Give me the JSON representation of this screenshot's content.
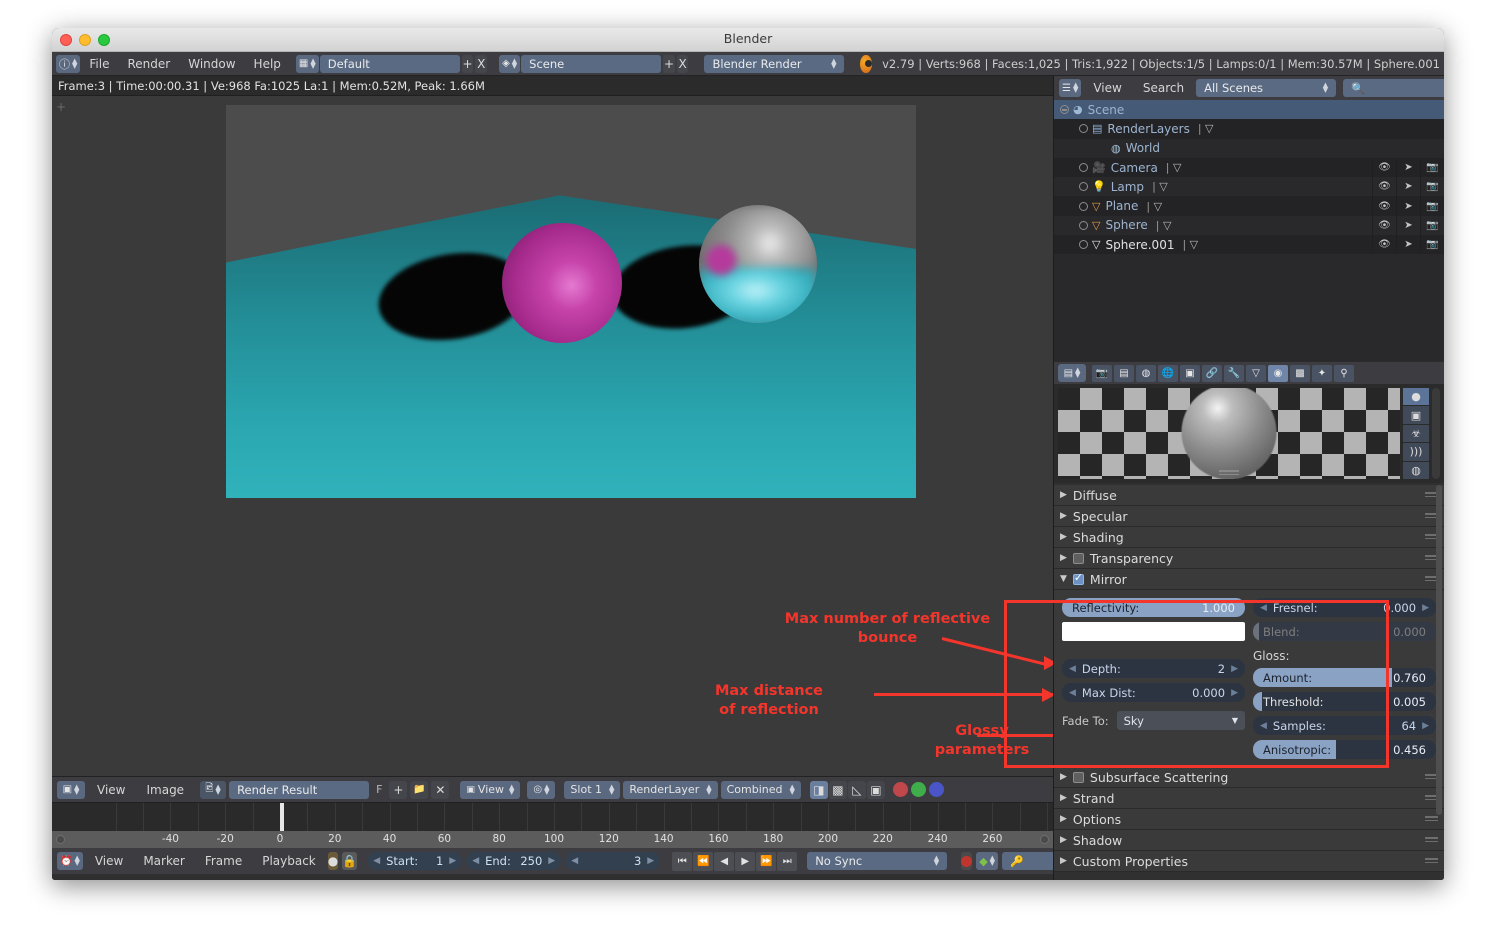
{
  "window": {
    "title": "Blender"
  },
  "topbar": {
    "info_icon": "info-icon",
    "menus": [
      "File",
      "Render",
      "Window",
      "Help"
    ],
    "screen_layout": "Default",
    "scene_name": "Scene",
    "engine": "Blender Render",
    "add_label": "+",
    "close_label": "X",
    "stats": "v2.79 | Verts:968 | Faces:1,025 | Tris:1,922 | Objects:1/5 | Lamps:0/1 | Mem:30.57M | Sphere.001"
  },
  "viewport": {
    "info": "Frame:3 | Time:00:00.31 | Ve:968 Fa:1025 La:1 | Mem:0.52M, Peak: 1.66M"
  },
  "annotations": [
    {
      "text": "Max number of reflective\nbounce"
    },
    {
      "text": "Max distance\nof reflection"
    },
    {
      "text": "Glossy\nparameters"
    }
  ],
  "image_editor": {
    "menus": [
      "View",
      "Image"
    ],
    "datablock": "Render Result",
    "fake_user": "F",
    "new_label": "+",
    "browse_label": "open-icon",
    "unlink_label": "X",
    "view_label": "View",
    "slot": "Slot 1",
    "layer": "RenderLayer",
    "pass": "Combined",
    "channel_buttons": [
      "color-and-alpha-icon",
      "alpha-icon",
      "z-depth-icon",
      "render-icon"
    ],
    "channel_dots": [
      "#c0484b",
      "#4caf50",
      "#4a56c8"
    ]
  },
  "image_ruler": {
    "labels": [
      "-40",
      "-20",
      "0",
      "20",
      "40",
      "60",
      "80",
      "100",
      "120",
      "140",
      "160",
      "180",
      "200",
      "220",
      "240",
      "260"
    ],
    "values": [
      -40,
      -20,
      0,
      20,
      40,
      60,
      80,
      100,
      120,
      140,
      160,
      180,
      200,
      220,
      240,
      260
    ]
  },
  "timeline": {
    "menus": [
      "View",
      "Marker",
      "Frame",
      "Playback"
    ],
    "auto_key_icon": "record-keying-icon",
    "lock_icon": "lock-icon",
    "start_label": "Start:",
    "start_value": "1",
    "end_label": "End:",
    "end_value": "250",
    "current_frame": "3",
    "transport": [
      "jump-start-icon",
      "prev-keyframe-icon",
      "play-reverse-icon",
      "play-icon",
      "next-keyframe-icon",
      "jump-end-icon"
    ],
    "sync_mode": "No Sync",
    "record_icon": "record-icon",
    "keying_set_icon": "keyingset-icon",
    "keyframe_type_icon": "keyframe-icon"
  },
  "outliner": {
    "header": {
      "display_mode_icon": "outliner-icon",
      "view": "View",
      "search": "Search",
      "scope": "All Scenes",
      "search_placeholder": ""
    },
    "rows": [
      {
        "name": "Scene",
        "indent": 0,
        "selected": true,
        "type": "scene",
        "toggles": false,
        "extra": ""
      },
      {
        "name": "RenderLayers",
        "indent": 1,
        "selected": false,
        "type": "layers",
        "toggles": false,
        "extra": "renderlayer-icon"
      },
      {
        "name": "World",
        "indent": 2,
        "selected": false,
        "type": "world",
        "toggles": false,
        "extra": ""
      },
      {
        "name": "Camera",
        "indent": 1,
        "selected": false,
        "type": "camera",
        "toggles": true,
        "extra": "camera-data-icon"
      },
      {
        "name": "Lamp",
        "indent": 1,
        "selected": false,
        "type": "lamp",
        "toggles": true,
        "extra": "lamp-data-icon"
      },
      {
        "name": "Plane",
        "indent": 1,
        "selected": false,
        "type": "mesh",
        "toggles": true,
        "extra": "mesh-data-icon"
      },
      {
        "name": "Sphere",
        "indent": 1,
        "selected": false,
        "type": "mesh",
        "toggles": true,
        "extra": "mesh-data-icon"
      },
      {
        "name": "Sphere.001",
        "indent": 1,
        "selected": false,
        "type": "mesh-sel",
        "toggles": true,
        "extra": "mesh-data-icon"
      }
    ],
    "column_icons": [
      "eye-icon",
      "cursor-arrow-icon",
      "camera-render-icon"
    ]
  },
  "properties": {
    "tabs": [
      "render-icon",
      "render-layers-icon",
      "scene-icon",
      "world-icon",
      "object-icon",
      "constraints-icon",
      "modifier-icon",
      "mesh-data-icon",
      "material-icon",
      "texture-icon",
      "particles-icon",
      "physics-icon"
    ],
    "active_tab_index": 8,
    "preview_side_buttons": [
      "preview-sphere-icon",
      "preview-cube-icon",
      "preview-monkey-icon",
      "preview-hair-icon",
      "preview-sphere-sky-icon"
    ],
    "panels": [
      {
        "label": "Diffuse",
        "open": false,
        "checkbox": null
      },
      {
        "label": "Specular",
        "open": false,
        "checkbox": null
      },
      {
        "label": "Shading",
        "open": false,
        "checkbox": null
      },
      {
        "label": "Transparency",
        "open": false,
        "checkbox": false
      },
      {
        "label": "Mirror",
        "open": true,
        "checkbox": true
      }
    ],
    "panels_after": [
      {
        "label": "Subsurface Scattering",
        "open": false,
        "checkbox": false
      },
      {
        "label": "Strand",
        "open": false,
        "checkbox": null
      },
      {
        "label": "Options",
        "open": false,
        "checkbox": null
      },
      {
        "label": "Shadow",
        "open": false,
        "checkbox": null
      },
      {
        "label": "Custom Properties",
        "open": false,
        "checkbox": null
      }
    ],
    "mirror": {
      "reflectivity_label": "Reflectivity:",
      "reflectivity_value": "1.000",
      "reflectivity_fraction": 1.0,
      "mirror_color": "#ffffff",
      "depth_label": "Depth:",
      "depth_value": "2",
      "maxdist_label": "Max Dist:",
      "maxdist_value": "0.000",
      "fade_label": "Fade To:",
      "fade_value": "Sky",
      "fresnel_label": "Fresnel:",
      "fresnel_value": "0.000",
      "blend_label": "Blend:",
      "blend_value": "0.000",
      "gloss_label": "Gloss:",
      "amount_label": "Amount:",
      "amount_value": "0.760",
      "amount_fraction": 0.76,
      "threshold_label": "Threshold:",
      "threshold_value": "0.005",
      "threshold_fraction": 0.05,
      "samples_label": "Samples:",
      "samples_value": "64",
      "anisotropic_label": "Anisotropic:",
      "anisotropic_value": "0.456",
      "anisotropic_fraction": 0.456
    }
  },
  "colors": {
    "annotation_red": "#f4352b",
    "header_blue": "#5a6a82",
    "panel_bg": "#3a3a3a",
    "slider_blue": "#8aa2c4"
  }
}
